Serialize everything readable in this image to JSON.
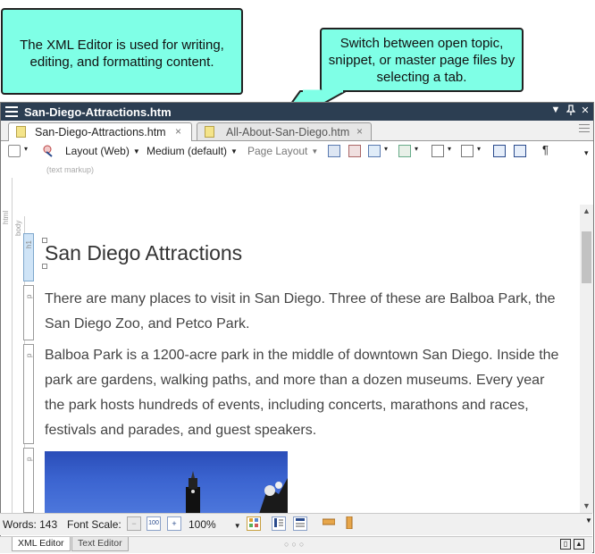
{
  "callouts": {
    "editor_note": "The XML Editor is used for writing, editing, and formatting content.",
    "tabs_note": "Switch between open topic, snippet, or master page files by selecting a tab."
  },
  "window": {
    "title": "San-Diego-Attractions.htm",
    "controls": {
      "menu": "▼",
      "pin": "🖈",
      "close": "✕"
    }
  },
  "tabs": [
    {
      "label": "San-Diego-Attractions.htm",
      "close": "×",
      "active": true
    },
    {
      "label": "All-About-San-Diego.htm",
      "close": "×",
      "active": false
    }
  ],
  "toolbar": {
    "layout": "Layout (Web)",
    "medium": "Medium (default)",
    "page_layout": "Page Layout",
    "pilcrow": "¶",
    "text_markup": "(text markup)"
  },
  "structure": {
    "html": "html",
    "body": "body",
    "h1": "h1",
    "p": "p"
  },
  "document": {
    "heading": "San Diego Attractions",
    "paragraphs": [
      "There are many places to visit in San Diego. Three of these are Balboa Park, the San Diego Zoo, and Petco Park.",
      "Balboa Park is a 1200-acre park in the middle of downtown San Diego. Inside the park are gardens, walking paths, and more than a dozen museums. Every year the park hosts hundreds of events, including concerts, marathons and races, festivals and parades, and guest speakers."
    ]
  },
  "status_bar": {
    "words": "Words: 143",
    "font_scale_label": "Font Scale:",
    "zoom": "100%"
  },
  "bottom_tabs": [
    {
      "label": "XML Editor",
      "active": true
    },
    {
      "label": "Text Editor",
      "active": false
    }
  ],
  "colors": {
    "callout_bg": "#7fffe6",
    "title_bar": "#2c3e52",
    "h1_tag": "#cfe4f7"
  }
}
